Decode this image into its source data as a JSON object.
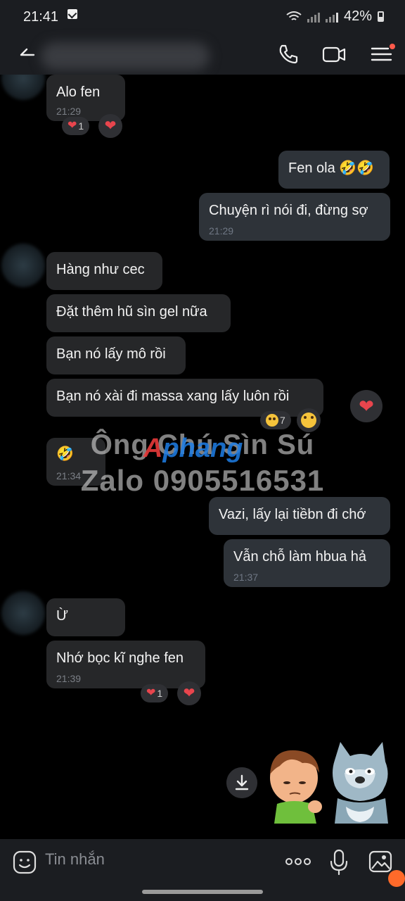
{
  "status_bar": {
    "time": "21:41",
    "battery": "42%"
  },
  "header": {
    "back_icon": "arrow-left-icon",
    "call_icon": "phone-icon",
    "video_icon": "video-camera-icon",
    "menu_icon": "list-menu-icon"
  },
  "messages": [
    {
      "side": "in",
      "text": "Alo fen",
      "time": "21:29",
      "reaction_count": "1"
    },
    {
      "side": "out",
      "text": "Fen ola 🤣🤣"
    },
    {
      "side": "out",
      "text": "Chuyện rì nói đi, đừng sợ",
      "time": "21:29"
    },
    {
      "side": "in",
      "text": "Hàng như cec"
    },
    {
      "side": "in",
      "text": "Đặt thêm hũ sìn gel nữa"
    },
    {
      "side": "in",
      "text": "Bạn nó lấy mô rồi"
    },
    {
      "side": "in",
      "text": "Bạn nó xài đi massa xang lấy luôn rồi",
      "reaction_count": "7"
    },
    {
      "side": "in",
      "text": "🤣",
      "time": "21:34"
    },
    {
      "side": "out",
      "text": "Vazi, lấy lại tiềbn đi chớ"
    },
    {
      "side": "out",
      "text": "Vẫn chỗ làm hbua hả",
      "time": "21:37"
    },
    {
      "side": "in",
      "text": "Ừ"
    },
    {
      "side": "in",
      "text": "Nhớ bọc kĩ nghe fen",
      "time": "21:39",
      "reaction_count": "1"
    }
  ],
  "watermark": {
    "line1": "Ông Chú Sìn Sú",
    "logo_a": "A",
    "logo_rest": "phang",
    "line2": "Zalo 0905516531"
  },
  "input_bar": {
    "placeholder": "Tin nhắn",
    "emoji_icon": "smiley-icon",
    "more_icon": "more-dots-icon",
    "mic_icon": "microphone-icon",
    "image_icon": "image-icon"
  },
  "colors": {
    "background": "#000000",
    "header": "#1b1d21",
    "incoming_bubble": "#262729",
    "outgoing_bubble": "#2e3339",
    "heart": "#e8454d"
  }
}
